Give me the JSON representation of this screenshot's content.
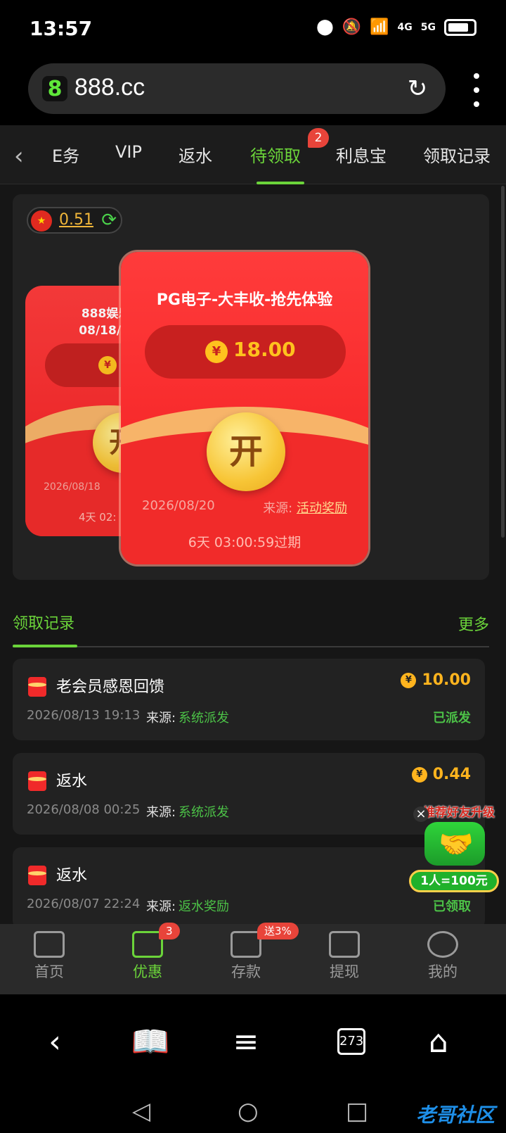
{
  "status_bar": {
    "time": "13:57",
    "net1": "4G",
    "net2": "5G"
  },
  "browser": {
    "badge": "8",
    "url": "888.cc"
  },
  "tabs": {
    "items": [
      "E务",
      "VIP",
      "返水",
      "待领取",
      "利息宝",
      "领取记录"
    ],
    "active": "待领取",
    "badge": "2"
  },
  "balance": {
    "value": "0.51"
  },
  "packets": [
    {
      "title": "888娱乐:\n08/18/28",
      "amount": "",
      "open": "开",
      "date": "2026/08/18",
      "expire": "4天 02:"
    },
    {
      "title": "PG电子-大丰收-抢先体验",
      "amount": "18.00",
      "open": "开",
      "date": "2026/08/20",
      "source_label": "来源:",
      "source": "活动奖励",
      "expire": "6天 03:00:59过期"
    }
  ],
  "records": {
    "title": "领取记录",
    "more": "更多",
    "items": [
      {
        "title": "老会员感恩回馈",
        "amount": "10.00",
        "time": "2026/08/13 19:13",
        "source_label": "来源:",
        "source": "系统派发",
        "status": "已派发"
      },
      {
        "title": "返水",
        "amount": "0.44",
        "time": "2026/08/08 00:25",
        "source_label": "来源:",
        "source": "系统派发",
        "status": ""
      },
      {
        "title": "返水",
        "amount": "",
        "time": "2026/08/07 22:24",
        "source_label": "来源:",
        "source": "返水奖励",
        "status": "已领取"
      }
    ]
  },
  "promo": {
    "title": "推荐好友升级",
    "badge": "1人=100元"
  },
  "bottom_tabs": {
    "items": [
      "首页",
      "优惠",
      "存款",
      "提现",
      "我的"
    ],
    "active": "优惠",
    "offer_badge": "3",
    "deposit_badge": "送3%"
  },
  "browser_nav": {
    "tab_count": "273"
  },
  "watermark": "老哥社区",
  "colors": {
    "accent": "#6bd43a",
    "packet_red": "#f21e20",
    "gold": "#ffc21e",
    "badge_red": "#e8443a"
  }
}
